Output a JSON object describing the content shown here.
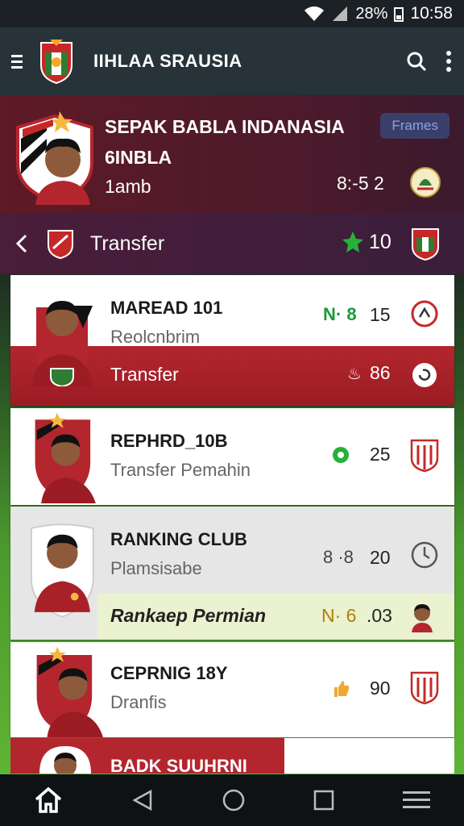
{
  "status": {
    "battery": "28%",
    "time": "10:58"
  },
  "appbar": {
    "title": "IIHLAA SRAUSIA"
  },
  "hero": {
    "line1": "SEPAK BABLA INDANASIA",
    "line2": "6INBLA",
    "line3": "1amb",
    "badge": "Frames",
    "score": "8:-5 2"
  },
  "subheader": {
    "label": "Transfer",
    "count": "10"
  },
  "cards": [
    {
      "name": "MAREAD 101",
      "sub": "Reolcnbrim",
      "code": "N· 8",
      "num": "15",
      "band_label": "Transfer",
      "band_num": "86"
    },
    {
      "name": "REPHRD_10B",
      "sub": "Transfer Pemahin",
      "num": "25"
    },
    {
      "name": "RANKING CLUB",
      "sub": "Plamsisabe",
      "code": "8 ·8",
      "num": "20",
      "band_label": "Rankaep Permian",
      "band_code": "N· 6",
      "band_num": ".03"
    },
    {
      "name": "CEPRNIG 18Y",
      "sub": "Dranfis",
      "num": "90"
    }
  ],
  "peek": {
    "label": "BADK SUUHRNI"
  },
  "colors": {
    "primary": "#273338",
    "hero": "#5e1a25",
    "accent_red": "#b3262e",
    "green": "#1a9a3a"
  }
}
